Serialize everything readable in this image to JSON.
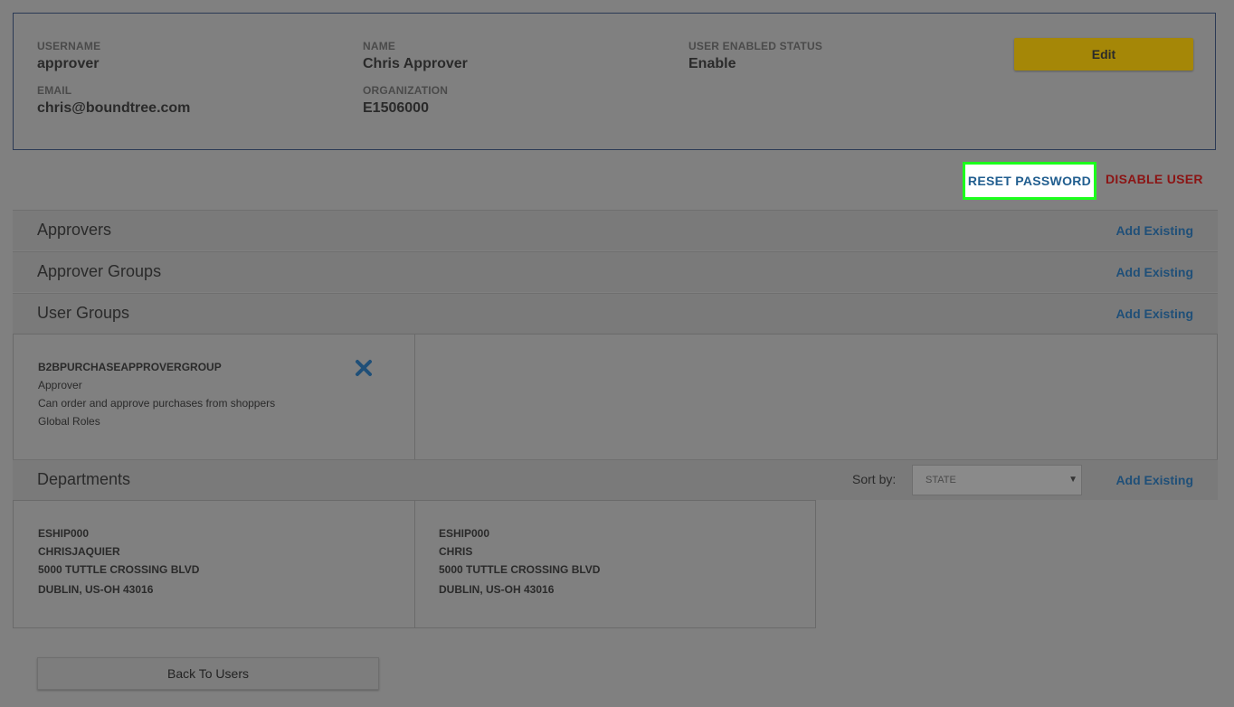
{
  "profile": {
    "username_label": "USERNAME",
    "username": "approver",
    "name_label": "NAME",
    "name": "Chris Approver",
    "status_label": "USER ENABLED STATUS",
    "status": "Enable",
    "email_label": "EMAIL",
    "email": "chris@boundtree.com",
    "org_label": "ORGANIZATION",
    "org": "E1506000",
    "edit_label": "Edit"
  },
  "actions": {
    "reset_password": "RESET PASSWORD",
    "disable_user": "DISABLE USER"
  },
  "sections": {
    "approvers": "Approvers",
    "approver_groups": "Approver Groups",
    "user_groups": "User Groups",
    "departments": "Departments",
    "add_existing": "Add Existing"
  },
  "user_groups": [
    {
      "name": "B2BPURCHASEAPPROVERGROUP",
      "role": "Approver",
      "description": "Can order and approve purchases from shoppers",
      "scope": "Global Roles"
    }
  ],
  "sort": {
    "label": "Sort by:",
    "selected": "STATE"
  },
  "departments": [
    {
      "code": "ESHIP000",
      "name": "CHRISJAQUIER",
      "address1": "5000 TUTTLE CROSSING BLVD",
      "address2": "DUBLIN, US-OH 43016"
    },
    {
      "code": "ESHIP000",
      "name": "CHRIS",
      "address1": "5000 TUTTLE CROSSING BLVD",
      "address2": "DUBLIN, US-OH 43016"
    }
  ],
  "back_label": "Back To Users",
  "colors": {
    "accent_blue": "#215e8f",
    "danger_red": "#8b1414",
    "edit_yellow": "#a58707",
    "highlight_green": "#1cff1c"
  }
}
